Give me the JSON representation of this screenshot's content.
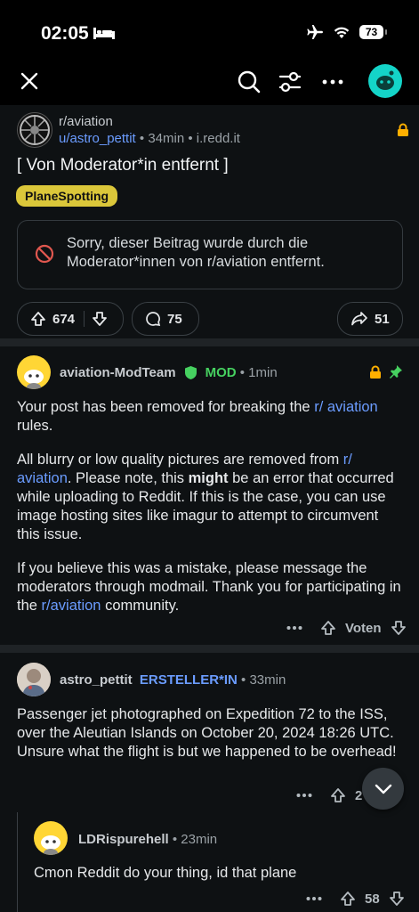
{
  "status_bar": {
    "time": "02:05",
    "battery": "73"
  },
  "post": {
    "subreddit": "r/aviation",
    "author": "u/astro_pettit",
    "age": "34min",
    "domain": "i.redd.it",
    "title": "[ Von Moderator*in entfernt ]",
    "flair": "PlaneSpotting",
    "removed_notice": "Sorry, dieser Beitrag wurde durch die Moderator*innen von r/aviation entfernt.",
    "upvotes": "674",
    "comments": "75",
    "shares": "51"
  },
  "mod_comment": {
    "author": "aviation-ModTeam",
    "badge": "MOD",
    "age": "1min",
    "p1_a": "Your post has been removed for breaking the ",
    "p1_link": "r/ aviation",
    "p1_b": " rules.",
    "p2_a": "All blurry or low quality pictures are removed from ",
    "p2_link": "r/ aviation",
    "p2_b": ". Please note, this ",
    "p2_bold": "might",
    "p2_c": " be an error that occurred while uploading to Reddit. If this is the case, you can use image hosting sites like imagur to attempt to circumvent this issue.",
    "p3_a": "If you believe this was a mistake, please message the moderators through modmail.  Thank you for participating in the ",
    "p3_link": "r/aviation",
    "p3_b": " community.",
    "vote_label": "Voten"
  },
  "op_comment": {
    "author": "astro_pettit",
    "badge": "ERSTELLER*IN",
    "age": "33min",
    "body": "Passenger jet photographed on Expedition 72 to the ISS, over the Aleutian Islands on October 20, 2024 18:26 UTC. Unsure what the flight is but we happened to be overhead!",
    "votes": "2"
  },
  "reply": {
    "author": "LDRispurehell",
    "age": "23min",
    "body": "Cmon Reddit do your thing, id that plane",
    "votes": "58"
  },
  "colors": {
    "accent": "#6b9cff",
    "mod_green": "#46d160",
    "flair": "#dbc73a",
    "lock": "#ffb000",
    "avatar": "#14d4c8"
  }
}
